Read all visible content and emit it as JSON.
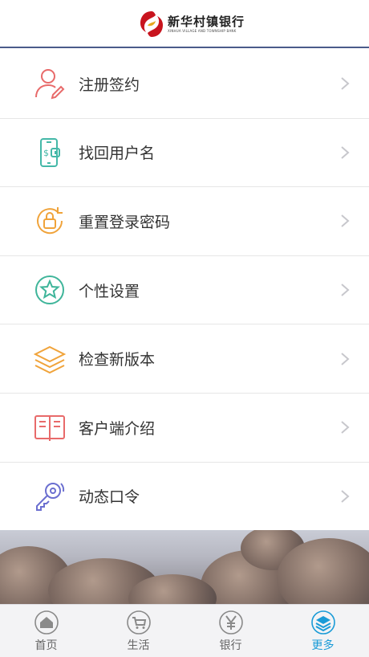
{
  "header": {
    "brand_cn": "新华村镇银行",
    "brand_en": "XINHUA VILLAGE AND TOWNSHIP BANK"
  },
  "menu": {
    "items": [
      {
        "label": "注册签约",
        "icon": "user-edit-icon",
        "color": "#e86a6a"
      },
      {
        "label": "找回用户名",
        "icon": "phone-dollar-icon",
        "color": "#44b8a8"
      },
      {
        "label": "重置登录密码",
        "icon": "lock-reset-icon",
        "color": "#f0a33a"
      },
      {
        "label": "个性设置",
        "icon": "star-icon",
        "color": "#3fb59a"
      },
      {
        "label": "检查新版本",
        "icon": "layers-icon",
        "color": "#f0a33a"
      },
      {
        "label": "客户端介绍",
        "icon": "book-icon",
        "color": "#e86a6a"
      },
      {
        "label": "动态口令",
        "icon": "key-icon",
        "color": "#6b6fd0"
      }
    ]
  },
  "tabbar": {
    "tabs": [
      {
        "label": "首页",
        "icon": "home-icon"
      },
      {
        "label": "生活",
        "icon": "cart-icon"
      },
      {
        "label": "银行",
        "icon": "yen-icon"
      },
      {
        "label": "更多",
        "icon": "layers-icon",
        "active": true
      }
    ]
  },
  "colors": {
    "accent": "#1a9bd7",
    "header_rule": "#4a5b8a"
  }
}
